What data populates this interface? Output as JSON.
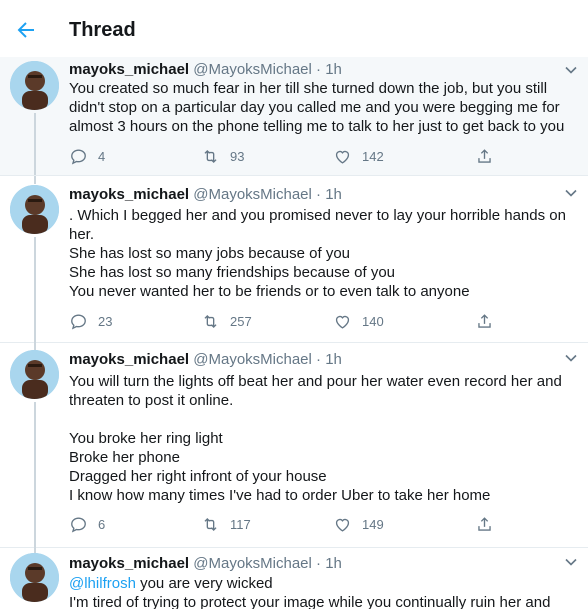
{
  "header": {
    "title": "Thread",
    "back_icon": "arrow-left-icon",
    "accent": "#1da1f2"
  },
  "tweets": [
    {
      "name": "mayoks_michael",
      "handle": "@MayoksMichael",
      "sep": "·",
      "time": "1h",
      "lines": [
        "You created so much fear in her till she turned down the job, but you still",
        "didn't stop on a particular day you called me and you were begging me for",
        "almost 3 hours on the phone telling me to talk to her just to get back to you"
      ],
      "replies": "4",
      "retweets": "93",
      "likes": "142"
    },
    {
      "name": "mayoks_michael",
      "handle": "@MayoksMichael",
      "sep": "·",
      "time": "1h",
      "lines": [
        ". Which I begged her and you promised never to lay your horrible hands on",
        "her.",
        "She has lost so many jobs because of you",
        "She has lost so many friendships because of you",
        "You never wanted her to be friends or to even talk to anyone"
      ],
      "replies": "23",
      "retweets": "257",
      "likes": "140"
    },
    {
      "name": "mayoks_michael",
      "handle": "@MayoksMichael",
      "sep": "·",
      "time": "1h",
      "lines": [
        "You will turn the lights off beat her and pour her water even record her and",
        "threaten to post it online.",
        "",
        "You broke her ring light",
        "Broke her phone",
        "Dragged her right infront of your house",
        "I know how many times I've had to order Uber to take her home"
      ],
      "replies": "6",
      "retweets": "117",
      "likes": "149"
    },
    {
      "name": "mayoks_michael",
      "handle": "@MayoksMichael",
      "sep": "·",
      "time": "1h",
      "mention": "@lhilfrosh",
      "lines": [
        " you are very wicked",
        "I'm tired of trying to protect your image while you continually ruin her and"
      ]
    }
  ]
}
